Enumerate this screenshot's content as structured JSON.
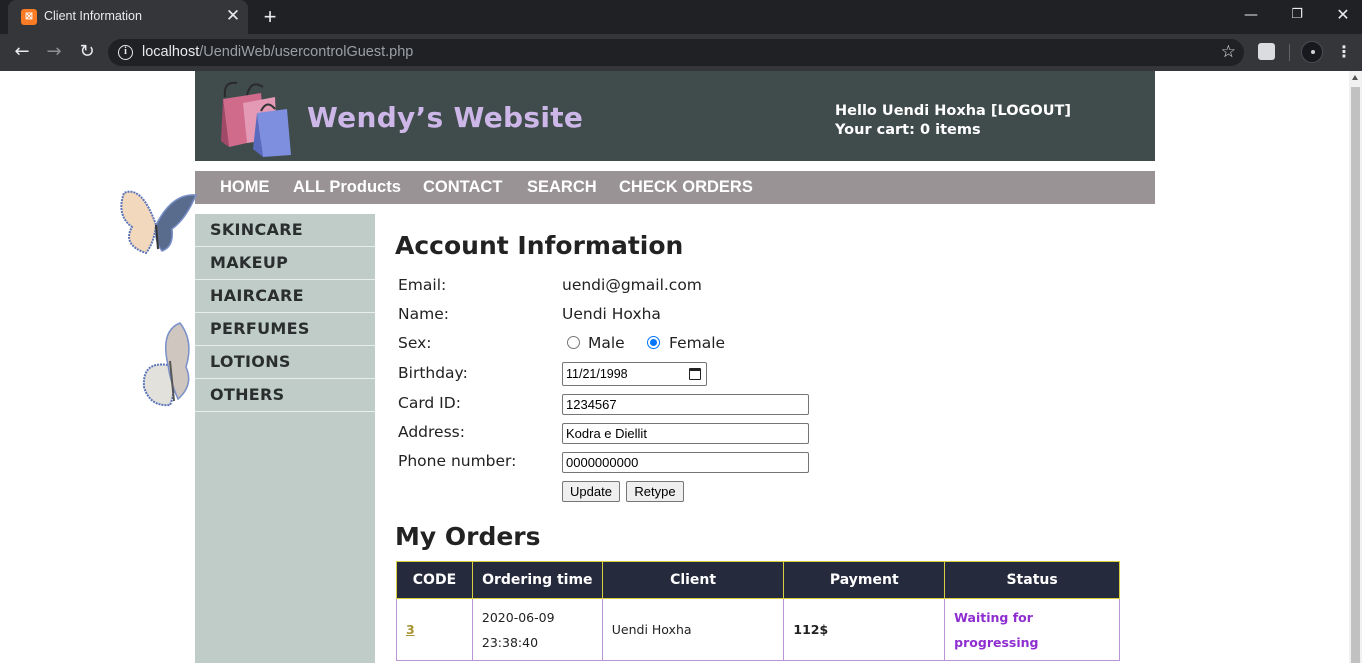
{
  "browser": {
    "tab_title": "Client Information",
    "url_host": "localhost",
    "url_path": "/UendiWeb/usercontrolGuest.php"
  },
  "header": {
    "site_title": "Wendy’s Website",
    "greeting": "Hello Uendi Hoxha [LOGOUT]",
    "cart": "Your cart: 0 items"
  },
  "topnav": [
    "HOME",
    "ALL Products",
    "CONTACT",
    "SEARCH",
    "CHECK ORDERS"
  ],
  "sidebar": [
    "SKINCARE",
    "MAKEUP",
    "HAIRCARE",
    "PERFUMES",
    "LOTIONS",
    "OTHERS"
  ],
  "account": {
    "heading": "Account Information",
    "labels": {
      "email": "Email:",
      "name": "Name:",
      "sex": "Sex:",
      "birthday": "Birthday:",
      "card": "Card ID:",
      "address": "Address:",
      "phone": "Phone number:"
    },
    "email": "uendi@gmail.com",
    "name": "Uendi Hoxha",
    "sex_options": [
      "Male",
      "Female"
    ],
    "sex_selected": "Female",
    "birthday": "11/21/1998",
    "card_id": "1234567",
    "address": "Kodra e Diellit",
    "phone": "0000000000",
    "update_label": "Update",
    "retype_label": "Retype"
  },
  "orders": {
    "heading": "My Orders",
    "columns": [
      "CODE",
      "Ordering time",
      "Client",
      "Payment",
      "Status"
    ],
    "rows": [
      {
        "code": "3",
        "time_date": "2020-06-09",
        "time_clock": "23:38:40",
        "client": "Uendi Hoxha",
        "payment": "112$",
        "status_line1": "Waiting for",
        "status_line2": "progressing"
      }
    ]
  },
  "colors": {
    "header_bg": "#404b4c",
    "nav_bg": "#999396",
    "sidebar_bg": "#bfccc8",
    "table_header_bg": "#262a3d",
    "status_color": "#8e2ed0"
  }
}
